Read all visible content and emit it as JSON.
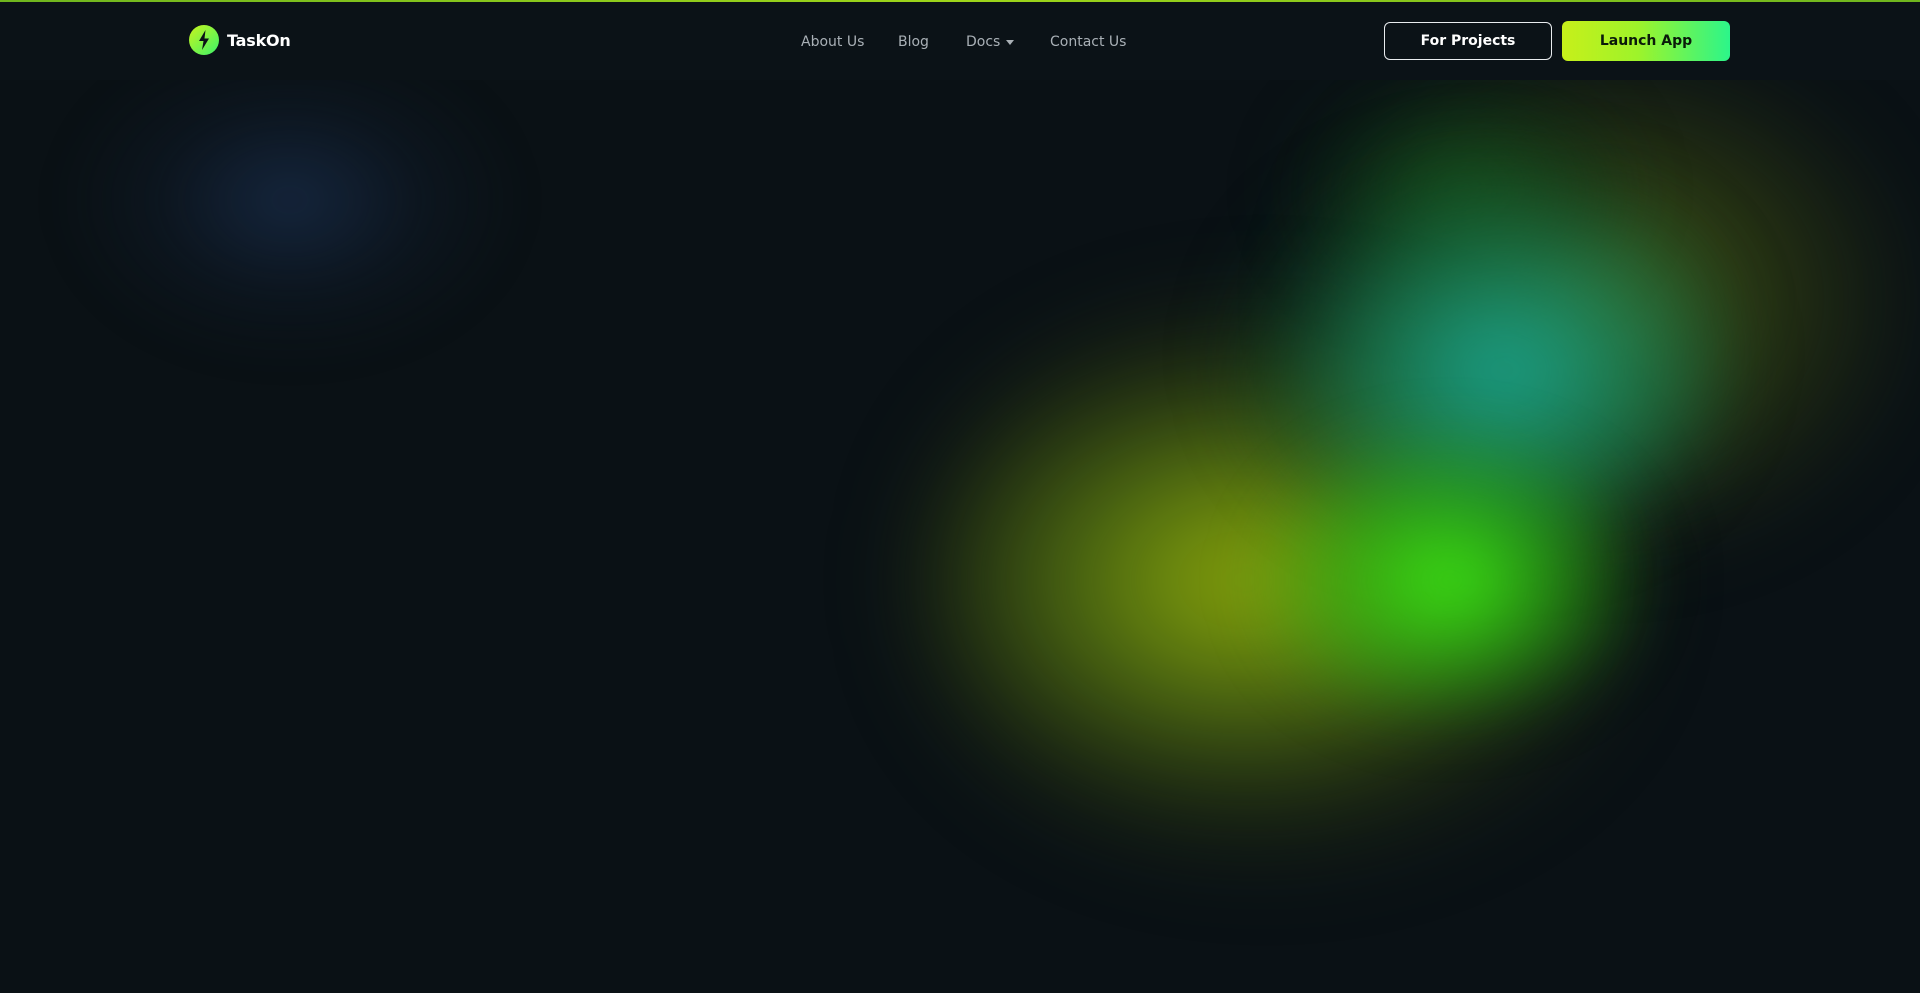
{
  "brand": {
    "name": "TaskOn",
    "icon": "lightning-bolt-icon",
    "colors": {
      "accent_start": "#c7f01a",
      "accent_end": "#2cf58a",
      "logo_green": "#5cf22a"
    }
  },
  "nav": {
    "items": [
      {
        "label": "About Us"
      },
      {
        "label": "Blog"
      },
      {
        "label": "Docs",
        "has_dropdown": true
      },
      {
        "label": "Contact Us"
      }
    ]
  },
  "header": {
    "for_projects_label": "For Projects",
    "launch_app_label": "Launch App"
  },
  "theme": {
    "background": "#0a1115",
    "header_background": "#0b1217",
    "nav_text": "#a9b0b6"
  }
}
